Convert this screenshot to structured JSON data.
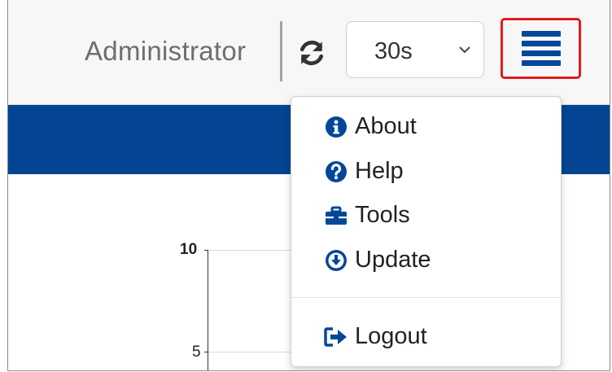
{
  "header": {
    "user_name": "Administrator",
    "refresh_icon": "refresh-icon",
    "interval": {
      "selected": "30s"
    },
    "menu_icon": "hamburger-menu-icon"
  },
  "chart": {
    "y_ticks": [
      "10",
      "5"
    ]
  },
  "menu": {
    "items": [
      {
        "label": "About",
        "icon": "info-circle-icon"
      },
      {
        "label": "Help",
        "icon": "question-circle-icon"
      },
      {
        "label": "Tools",
        "icon": "toolbox-icon"
      },
      {
        "label": "Update",
        "icon": "download-circle-icon"
      }
    ],
    "logout": {
      "label": "Logout",
      "icon": "sign-out-icon"
    }
  },
  "colors": {
    "brand_blue": "#044798",
    "highlight_red": "#e11b1b"
  }
}
